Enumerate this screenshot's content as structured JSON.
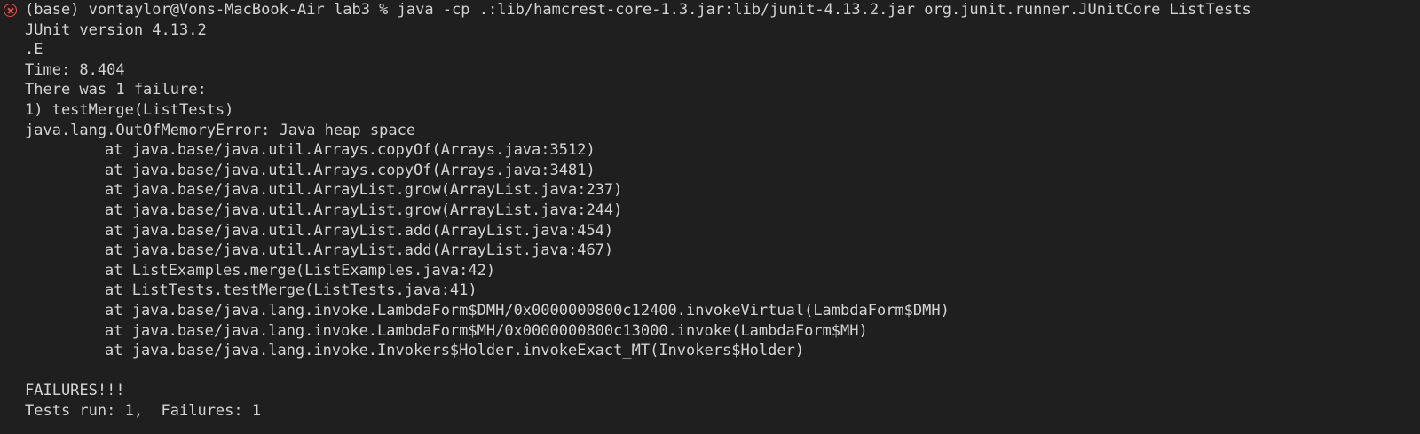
{
  "command_line": "(base) vontaylor@Vons-MacBook-Air lab3 % java -cp .:lib/hamcrest-core-1.3.jar:lib/junit-4.13.2.jar org.junit.runner.JUnitCore ListTests",
  "status_icon": "error-circle-icon",
  "error_color": "#f14c4c",
  "output": {
    "version": "JUnit version 4.13.2",
    "progress": ".E",
    "time": "Time: 8.404",
    "failure_summary": "There was 1 failure:",
    "failure_test": "1) testMerge(ListTests)",
    "exception": "java.lang.OutOfMemoryError: Java heap space",
    "stack": [
      "at java.base/java.util.Arrays.copyOf(Arrays.java:3512)",
      "at java.base/java.util.Arrays.copyOf(Arrays.java:3481)",
      "at java.base/java.util.ArrayList.grow(ArrayList.java:237)",
      "at java.base/java.util.ArrayList.grow(ArrayList.java:244)",
      "at java.base/java.util.ArrayList.add(ArrayList.java:454)",
      "at java.base/java.util.ArrayList.add(ArrayList.java:467)",
      "at ListExamples.merge(ListExamples.java:42)",
      "at ListTests.testMerge(ListTests.java:41)",
      "at java.base/java.lang.invoke.LambdaForm$DMH/0x0000000800c12400.invokeVirtual(LambdaForm$DMH)",
      "at java.base/java.lang.invoke.LambdaForm$MH/0x0000000800c13000.invoke(LambdaForm$MH)",
      "at java.base/java.lang.invoke.Invokers$Holder.invokeExact_MT(Invokers$Holder)"
    ],
    "failures_banner": "FAILURES!!!",
    "tests_run": "Tests run: 1,  Failures: 1"
  }
}
